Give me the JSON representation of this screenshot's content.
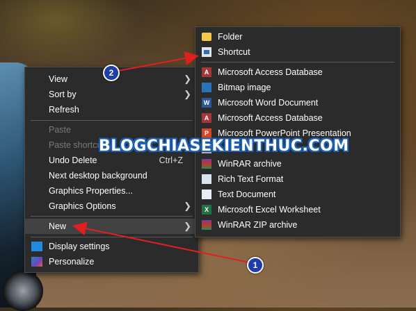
{
  "context_menu": {
    "items": [
      {
        "label": "View",
        "disabled": false,
        "submenu": true
      },
      {
        "label": "Sort by",
        "disabled": false,
        "submenu": true
      },
      {
        "label": "Refresh",
        "disabled": false
      },
      {
        "label": "Paste",
        "disabled": true
      },
      {
        "label": "Paste shortcut",
        "disabled": true
      },
      {
        "label": "Undo Delete",
        "shortcut": "Ctrl+Z",
        "disabled": false
      },
      {
        "label": "Next desktop background",
        "disabled": false
      },
      {
        "label": "Graphics Properties...",
        "disabled": false
      },
      {
        "label": "Graphics Options",
        "disabled": false,
        "submenu": true
      },
      {
        "label": "New",
        "disabled": false,
        "submenu": true,
        "highlighted": true
      },
      {
        "label": "Display settings",
        "icon": "display-icon"
      },
      {
        "label": "Personalize",
        "icon": "personalize-icon"
      }
    ]
  },
  "new_submenu": {
    "items": [
      {
        "label": "Folder",
        "icon": "folder-icon"
      },
      {
        "label": "Shortcut",
        "icon": "shortcut-icon"
      },
      {
        "label": "Microsoft Access Database",
        "icon": "access-icon"
      },
      {
        "label": "Bitmap image",
        "icon": "bitmap-icon"
      },
      {
        "label": "Microsoft Word Document",
        "icon": "word-icon"
      },
      {
        "label": "Microsoft Access Database",
        "icon": "access-icon"
      },
      {
        "label": "Microsoft PowerPoint Presentation",
        "icon": "powerpoint-icon"
      },
      {
        "label": "",
        "icon": "license-icon"
      },
      {
        "label": "WinRAR archive",
        "icon": "winrar-icon"
      },
      {
        "label": "Rich Text Format",
        "icon": "rtf-icon"
      },
      {
        "label": "Text Document",
        "icon": "text-document-icon"
      },
      {
        "label": "Microsoft Excel Worksheet",
        "icon": "excel-icon"
      },
      {
        "label": "WinRAR ZIP archive",
        "icon": "winrar-zip-icon"
      }
    ]
  },
  "annotations": {
    "watermark": "BLOGCHIASEKIENTHUC.COM",
    "badge_1": "1",
    "badge_2": "2",
    "arrow_color": "#e02020"
  }
}
